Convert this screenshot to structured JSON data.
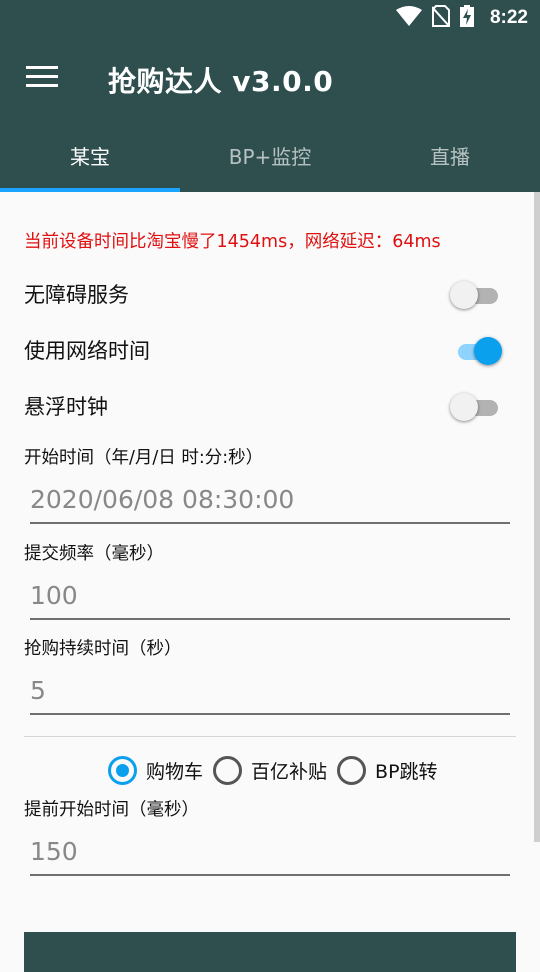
{
  "status_bar": {
    "time": "8:22",
    "icons": [
      "wifi-icon",
      "no-sim-icon",
      "battery-charging-icon"
    ]
  },
  "app_bar": {
    "title": "抢购达人 v3.0.0",
    "menu_icon": "hamburger-menu-icon"
  },
  "tabs": [
    {
      "label": "某宝",
      "active": true
    },
    {
      "label": "BP+监控",
      "active": false
    },
    {
      "label": "直播",
      "active": false
    }
  ],
  "warning_text": "当前设备时间比淘宝慢了1454ms，网络延迟：64ms",
  "toggles": [
    {
      "label": "无障碍服务",
      "on": false
    },
    {
      "label": "使用网络时间",
      "on": true
    },
    {
      "label": "悬浮时钟",
      "on": false
    }
  ],
  "fields": {
    "start_time": {
      "label": "开始时间（年/月/日 时:分:秒）",
      "value": "2020/06/08 08:30:00"
    },
    "frequency": {
      "label": "提交频率（毫秒）",
      "value": "100"
    },
    "duration": {
      "label": "抢购持续时间（秒）",
      "value": "5"
    },
    "advance": {
      "label": "提前开始时间（毫秒）",
      "value": "150"
    }
  },
  "radio_options": [
    {
      "label": "购物车",
      "checked": true
    },
    {
      "label": "百亿补贴",
      "checked": false
    },
    {
      "label": "BP跳转",
      "checked": false
    }
  ],
  "colors": {
    "primary": "#2f4f4f",
    "accent": "#0aa0ee",
    "warning": "#e01010"
  }
}
